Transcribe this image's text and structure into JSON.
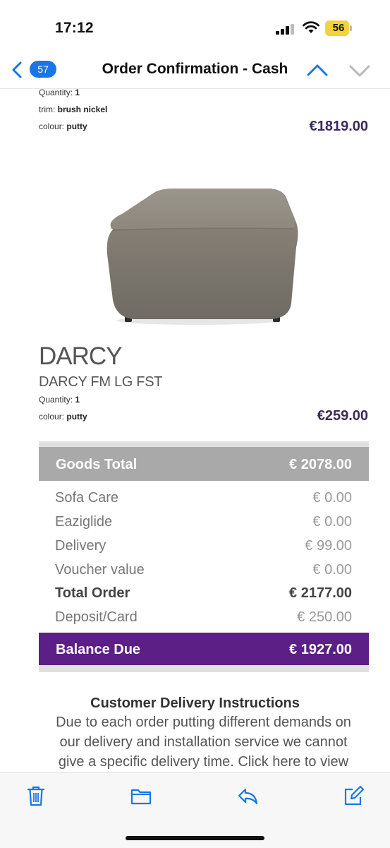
{
  "status_bar": {
    "time": "17:12",
    "battery_level": "56",
    "battery_color": "#f4d33a"
  },
  "nav": {
    "unread_count": "57",
    "title": "Order Confirmation - Cash",
    "accent_color": "#1976e8"
  },
  "items": [
    {
      "attributes": [
        {
          "label": "Quantity:",
          "value": "1"
        },
        {
          "label": "trim:",
          "value": "brush nickel"
        },
        {
          "label": "colour:",
          "value": "putty"
        }
      ],
      "price": "€1819.00"
    },
    {
      "name": "DARCY",
      "code": "DARCY FM LG FST",
      "image": "grey-fabric-footstool",
      "attributes": [
        {
          "label": "Quantity:",
          "value": "1"
        },
        {
          "label": "colour:",
          "value": "putty"
        }
      ],
      "price": "€259.00"
    }
  ],
  "totals": {
    "goods_total": {
      "label": "Goods Total",
      "value": "€ 2078.00"
    },
    "lines": [
      {
        "label": "Sofa Care",
        "value": "€ 0.00"
      },
      {
        "label": "Eaziglide",
        "value": "€ 0.00"
      },
      {
        "label": "Delivery",
        "value": "€ 99.00"
      },
      {
        "label": "Voucher value",
        "value": "€ 0.00"
      },
      {
        "label": "Total Order",
        "value": "€ 2177.00"
      },
      {
        "label": "Deposit/Card",
        "value": "€ 250.00"
      }
    ],
    "balance_due": {
      "label": "Balance Due",
      "value": "€ 1927.00"
    },
    "balance_color": "#5b1f86"
  },
  "instructions": {
    "title": "Customer Delivery Instructions",
    "body": "Due to each order putting different demands on our delivery and installation service we cannot give a specific delivery time. Click here to view delivery terms & conditions"
  },
  "toolbar": {
    "icons": [
      "trash-icon",
      "folder-icon",
      "reply-icon",
      "compose-icon"
    ]
  }
}
